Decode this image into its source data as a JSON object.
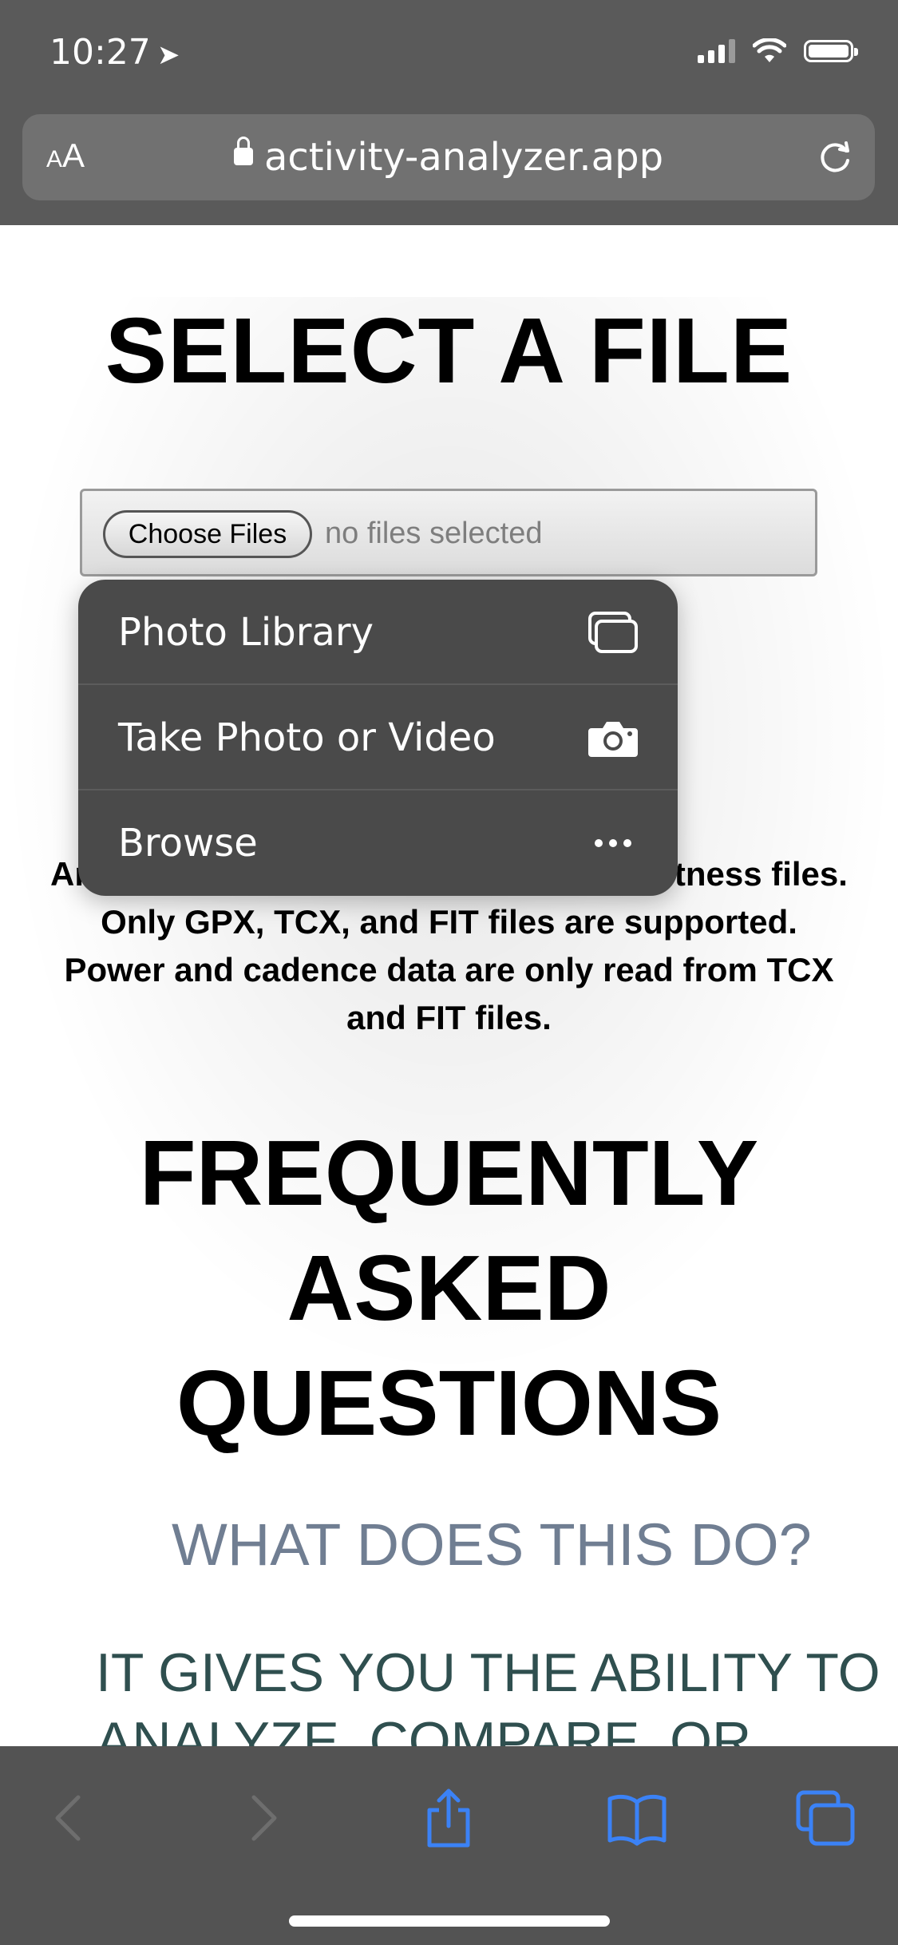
{
  "status_bar": {
    "time": "10:27",
    "location_arrow": "➤"
  },
  "browser": {
    "text_size_small": "A",
    "text_size_large": "A",
    "url": "activity-analyzer.app"
  },
  "page": {
    "title": "SELECT A FILE",
    "file_input": {
      "button_label": "Choose Files",
      "status": "no files selected"
    },
    "description_lines": [
      "Analyze and compare one or multiple fitness files.",
      "Only GPX, TCX, and FIT files are supported.",
      "Power and cadence data are only read from TCX",
      "and FIT files."
    ],
    "faq_title_lines": [
      "FREQUENTLY",
      "ASKED",
      "QUESTIONS"
    ],
    "faq_question": "WHAT DOES THIS DO?",
    "faq_answer_lines": [
      "IT GIVES YOU THE ABILITY TO",
      "ANALYZE, COMPARE, OR"
    ]
  },
  "menu": {
    "items": [
      {
        "label": "Photo Library",
        "icon": "photo-library-icon"
      },
      {
        "label": "Take Photo or Video",
        "icon": "camera-icon"
      },
      {
        "label": "Browse",
        "icon": "more-icon"
      }
    ]
  },
  "toolbar": {
    "icons": [
      "back-icon",
      "forward-icon",
      "share-icon",
      "bookmarks-icon",
      "tabs-icon"
    ]
  },
  "colors": {
    "chrome": "#5a5a5a",
    "toolbar": "#535353",
    "accent": "#3b82f6",
    "question": "#707e92",
    "answer": "#2f4f4f"
  }
}
